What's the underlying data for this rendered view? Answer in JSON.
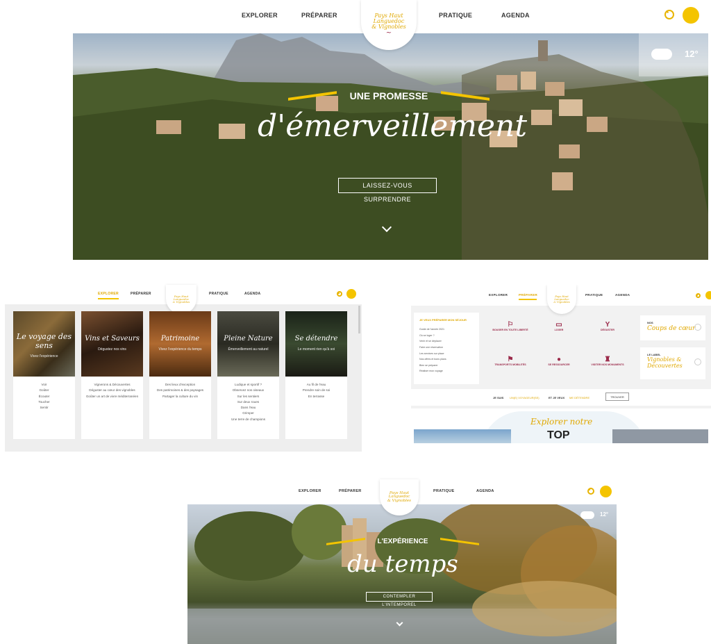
{
  "screen1": {
    "nav": {
      "explorer": "EXPLORER",
      "preparer": "PRÉPARER",
      "pratique": "PRATIQUE",
      "agenda": "AGENDA"
    },
    "logo": {
      "line1": "Pays Haut",
      "line2": "Languedoc",
      "line3": "& Vignobles"
    },
    "weather": {
      "temp": "12°",
      "icon": "cloud-icon"
    },
    "hero": {
      "kicker": "UNE PROMESSE",
      "script": "d'émerveillement",
      "cta": "LAISSEZ-VOUS SURPRENDRE"
    }
  },
  "screen2": {
    "nav": {
      "explorer": "EXPLORER",
      "preparer": "PRÉPARER",
      "pratique": "PRATIQUE",
      "agenda": "AGENDA"
    },
    "cards": [
      {
        "title": "Le voyage des sens",
        "subtitle": "Vivez l'expérience",
        "items": [
          "Voir",
          "Goûter",
          "Écouter",
          "Toucher",
          "Sentir"
        ]
      },
      {
        "title": "Vins et Saveurs",
        "subtitle": "Dégustez nos vins",
        "items": [
          "Vignerons & Découvertes",
          "Déguster au cœur des vignobles",
          "Goûter un art de vivre méditerranéen"
        ]
      },
      {
        "title": "Patrimoine",
        "subtitle": "Vivez l'expérience du temps",
        "items": [
          "Des lieux d'exception",
          "Des patrimoines & des paysages",
          "Partager la culture du vin"
        ]
      },
      {
        "title": "Pleine Nature",
        "subtitle": "Émerveillement au naturel",
        "items": [
          "Ludique et sportif ?",
          "Observez nos oiseaux",
          "Sur les sentiers",
          "Sur deux roues",
          "Dans l'eau",
          "Grimper",
          "Une terre de champions"
        ]
      },
      {
        "title": "Se détendre",
        "subtitle": "Le moment rien qu'à soi",
        "items": [
          "Au fil de l'eau",
          "Prendre soin de soi",
          "En terrasse"
        ]
      }
    ]
  },
  "screen3": {
    "nav": {
      "explorer": "EXPLORER",
      "preparer": "PRÉPARER",
      "pratique": "PRATIQUE",
      "agenda": "AGENDA"
    },
    "side": {
      "title": "JE VEUX PRÉPARER MON SÉJOUR",
      "links": [
        "Guide de l'année 2021",
        "Où se loger ?",
        "Venir et se déplacer",
        "Faire une réservation",
        "Les services sur place",
        "Nos offres et bons plans",
        "Bien se préparer",
        "Réaliser mon voyage"
      ]
    },
    "icons": [
      {
        "label": "BOUGER EN TOUTE LIBERTÉ",
        "icon": "walker-icon"
      },
      {
        "label": "LOGER",
        "icon": "bed-icon"
      },
      {
        "label": "DÉGUSTER",
        "icon": "glass-icon"
      },
      {
        "label": "TRANSPORTS MOBILITÉS",
        "icon": "hiker-icon"
      },
      {
        "label": "SE RESSOURCER",
        "icon": "ticket-icon"
      },
      {
        "label": "VISITER NOS MONUMENTS",
        "icon": "tower-icon"
      }
    ],
    "promo1": {
      "kicker": "NOS",
      "script": "Coups de cœur"
    },
    "promo2": {
      "kicker": "LE LABEL",
      "script": "Vignobles & Découvertes"
    },
    "bar": {
      "a": "JE SUIS",
      "b": "UN(E) VOYAGEUR(SE)",
      "c": "ET JE VEUX",
      "d": "ME DÉTENDRE",
      "btn": "TROUVER"
    },
    "explore": {
      "script": "Explorer notre",
      "top": "TOP"
    }
  },
  "screen4": {
    "nav": {
      "explorer": "EXPLORER",
      "preparer": "PRÉPARER",
      "pratique": "PRATIQUE",
      "agenda": "AGENDA"
    },
    "weather": {
      "temp": "12°",
      "icon": "cloud-icon"
    },
    "hero": {
      "kicker": "L'EXPÉRIENCE",
      "script": "du temps",
      "cta": "CONTEMPLER L'INTEMPOREL"
    }
  },
  "colors": {
    "accent": "#f4c400",
    "dark": "#333333",
    "wine": "#9b2a4a"
  }
}
